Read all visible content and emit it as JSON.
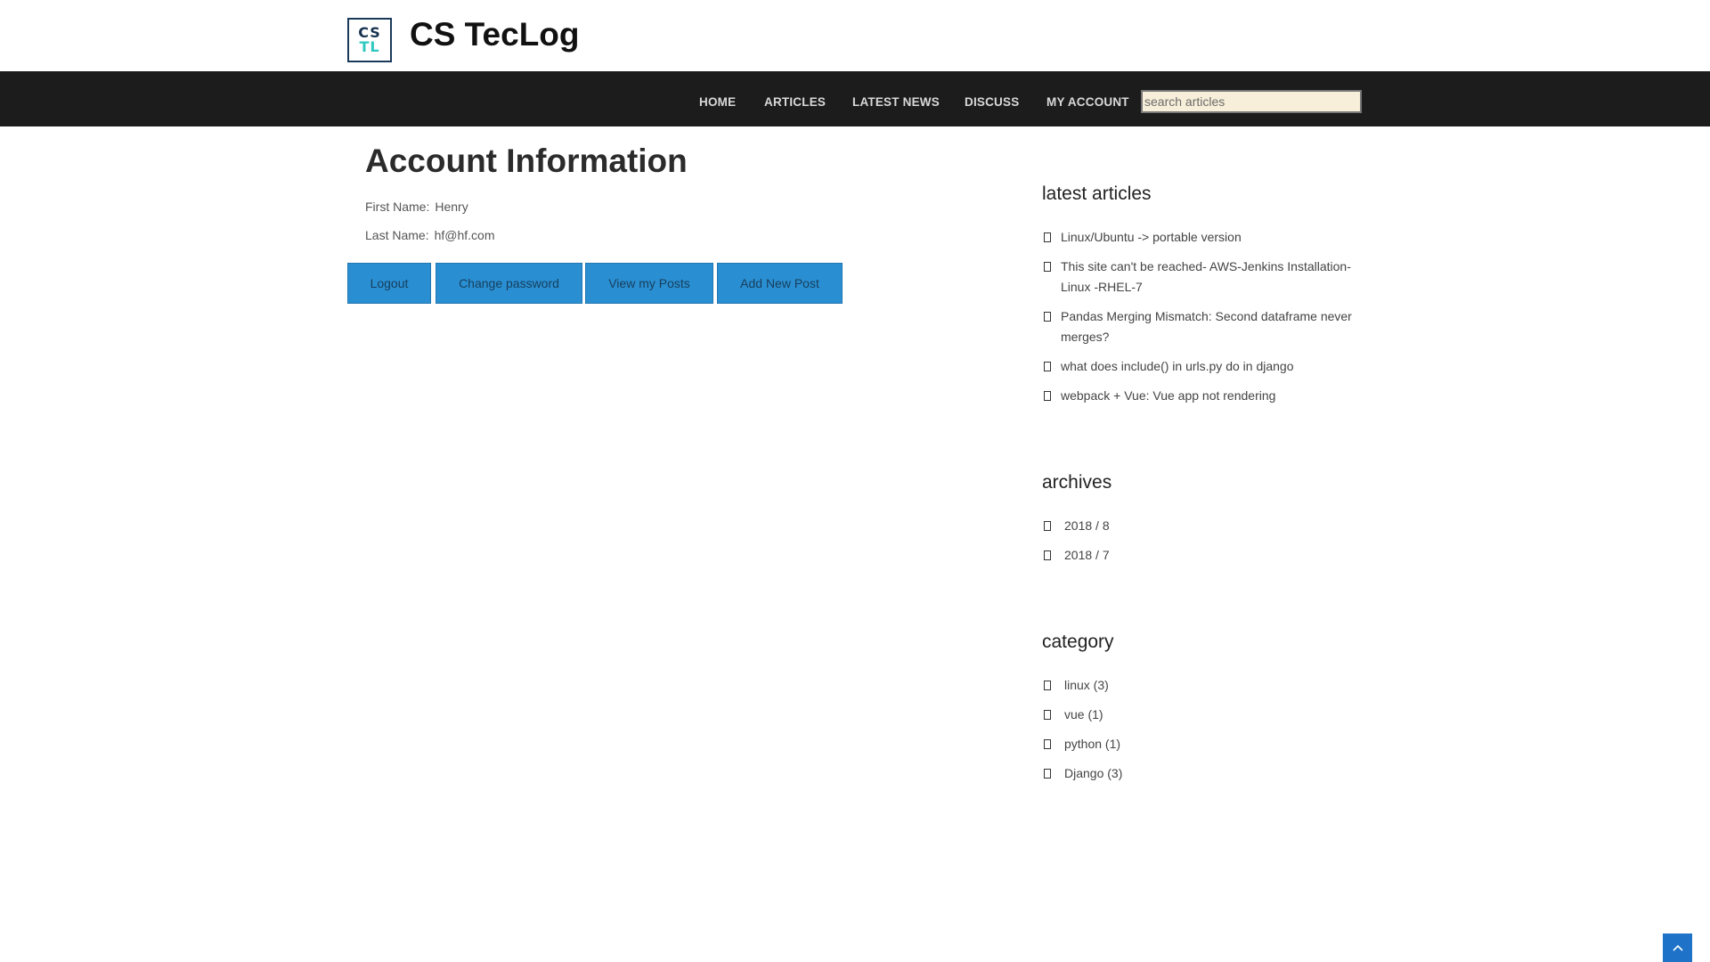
{
  "header": {
    "logo_top": "CS",
    "logo_bottom": "TL",
    "site_title": "CS TecLog"
  },
  "nav": {
    "items": [
      "HOME",
      "ARTICLES",
      "LATEST NEWS",
      "DISCUSS",
      "MY ACCOUNT"
    ],
    "search_placeholder": "search articles"
  },
  "main": {
    "title": "Account Information",
    "first_name_label": "First Name:",
    "first_name_value": "Henry",
    "last_name_label": "Last Name:",
    "last_name_value": "hf@hf.com",
    "buttons": [
      "Logout",
      "Change password",
      "View my Posts",
      "Add New Post"
    ]
  },
  "sidebar": {
    "latest_heading": "latest articles",
    "latest": [
      "Linux/Ubuntu -> portable version",
      "This site can't be reached- AWS-Jenkins Installation-Linux -RHEL-7",
      "Pandas Merging Mismatch: Second dataframe never merges?",
      "what does include() in urls.py do in django",
      "webpack + Vue: Vue app not rendering"
    ],
    "archives_heading": "archives",
    "archives": [
      "2018 / 8",
      "2018 / 7"
    ],
    "category_heading": "category",
    "categories": [
      "linux (3)",
      "vue (1)",
      "python (1)",
      "Django (3)"
    ]
  },
  "colors": {
    "nav_bg": "#1c1c1c",
    "button_bg": "#2a8fd2",
    "search_bg": "#f7efd9",
    "back_to_top": "#1e72c8"
  },
  "icons": {
    "back_to_top": "chevron-up-icon"
  }
}
